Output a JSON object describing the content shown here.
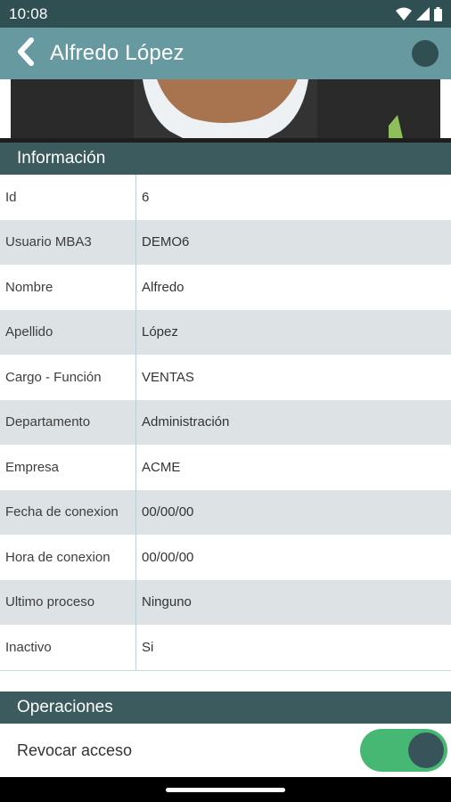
{
  "status_bar": {
    "time": "10:08",
    "icons": [
      "wifi-icon",
      "signal-icon",
      "battery-icon"
    ]
  },
  "app_bar": {
    "back_icon": "chevron-left-icon",
    "title": "Alfredo López"
  },
  "info_section": {
    "title": "Información",
    "rows": [
      {
        "label": "Id",
        "value": "6"
      },
      {
        "label": "Usuario MBA3",
        "value": "DEMO6"
      },
      {
        "label": "Nombre",
        "value": "Alfredo"
      },
      {
        "label": "Apellido",
        "value": "López"
      },
      {
        "label": "Cargo - Función",
        "value": "VENTAS"
      },
      {
        "label": "Departamento",
        "value": "Administración"
      },
      {
        "label": "Empresa",
        "value": "ACME"
      },
      {
        "label": "Fecha de conexion",
        "value": "00/00/00"
      },
      {
        "label": "Hora de conexion",
        "value": "00/00/00"
      },
      {
        "label": "Ultimo proceso",
        "value": "Ninguno"
      },
      {
        "label": "Inactivo",
        "value": "Si"
      }
    ]
  },
  "operations_section": {
    "title": "Operaciones",
    "revoke_label": "Revocar acceso",
    "revoke_enabled": true
  },
  "colors": {
    "status_bar": "#2f4f53",
    "app_bar": "#679aa0",
    "section_header": "#3b5b5e",
    "row_alt": "#dde3e4",
    "toggle_on": "#46b873"
  }
}
